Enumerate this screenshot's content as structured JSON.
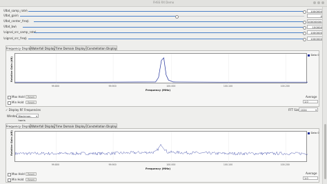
{
  "window": {
    "title": "FHSS RX Demo"
  },
  "params": [
    {
      "label": "\\ifbd_samp_rate\\",
      "value": "1000000",
      "fraction": 1.0
    },
    {
      "label": "\\ifbd_gain\\",
      "value": "0",
      "fraction": 0.55
    },
    {
      "label": "\\ifbd_center_freq\\",
      "value": "100000000",
      "fraction": 1.0
    },
    {
      "label": "\\ifbd_bw\\",
      "value": "100000",
      "fraction": 1.0
    },
    {
      "label": "\\signal_src_samp_rate\\",
      "value": "1000000",
      "fraction": 1.0
    },
    {
      "label": "\\signal_src_freq\\",
      "value": "1000000",
      "fraction": 1.0
    }
  ],
  "tabs": [
    "Frequency Display",
    "Waterfall Display",
    "Time Domain Display",
    "Constellation Display"
  ],
  "plot_common": {
    "ylabel": "Relative Gain (dB)",
    "xlabel": "Frequency (MHz)",
    "xticks": [
      "99.800",
      "99.900",
      "100.000",
      "100.100",
      "100.200"
    ],
    "legend": "Data 0",
    "line_color": "#1f2f9a"
  },
  "top_panel": {
    "max_hold": "Max Hold",
    "min_hold": "Min Hold",
    "reset": "Reset",
    "average_label": "Average",
    "average_value": "1.0"
  },
  "rf_options": {
    "display_rf": "Display RF Frequencies",
    "window_label": "Window:",
    "window_value": "Blackman-harris",
    "fft_label": "FFT Size",
    "fft_value": "1024"
  },
  "bottom_panel": {
    "max_hold": "Max Hold",
    "min_hold": "Min Hold",
    "reset": "Reset",
    "average_label": "Average",
    "average_value": "1.0"
  },
  "chart_data": [
    {
      "type": "line",
      "xlabel": "Frequency (MHz)",
      "ylabel": "Relative Gain (dB)",
      "xlim": [
        99.75,
        100.25
      ],
      "series": [
        {
          "name": "Data 0",
          "x": [
            99.75,
            99.9,
            99.99,
            99.995,
            100.0,
            100.004,
            100.008,
            100.012,
            100.02,
            100.1,
            100.25
          ],
          "values": [
            0.02,
            0.02,
            0.03,
            0.2,
            0.85,
            0.95,
            0.3,
            0.1,
            0.03,
            0.02,
            0.02
          ]
        }
      ]
    },
    {
      "type": "line",
      "xlabel": "Frequency (MHz)",
      "ylabel": "Relative Gain (dB)",
      "xlim": [
        99.75,
        100.25
      ],
      "series": [
        {
          "name": "Data 0",
          "note_shape": "noise floor with small peak near 100.000",
          "x": [
            99.75,
            99.9,
            99.99,
            100.0,
            100.01,
            100.1,
            100.25
          ],
          "values": [
            0.25,
            0.25,
            0.3,
            0.6,
            0.3,
            0.25,
            0.25
          ]
        }
      ]
    }
  ]
}
